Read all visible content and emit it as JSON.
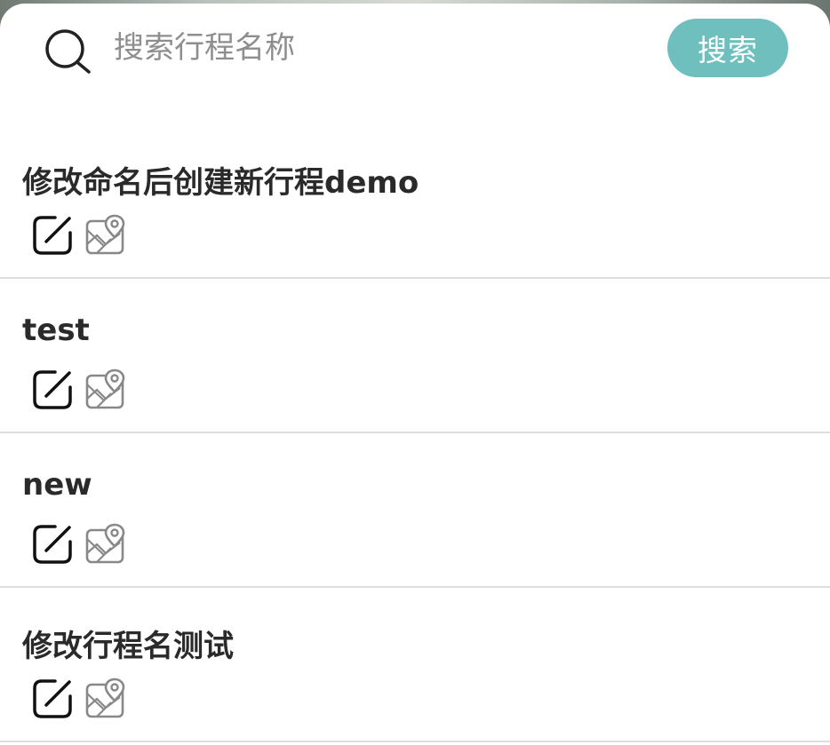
{
  "search": {
    "placeholder": "搜索行程名称",
    "button_label": "搜索"
  },
  "trips": [
    {
      "title": "修改命名后创建新行程demo",
      "edit_icon": "edit-icon",
      "map_icon": "map-pin-icon"
    },
    {
      "title": "test",
      "edit_icon": "edit-icon",
      "map_icon": "map-pin-icon"
    },
    {
      "title": "new",
      "edit_icon": "edit-icon",
      "map_icon": "map-pin-icon"
    },
    {
      "title": "修改行程名测试",
      "edit_icon": "edit-icon",
      "map_icon": "map-pin-icon"
    }
  ],
  "colors": {
    "accent": "#6fbfbf",
    "divider": "#dddddd",
    "title_text": "#2a2a2a",
    "placeholder_text": "#8e8e8e"
  }
}
